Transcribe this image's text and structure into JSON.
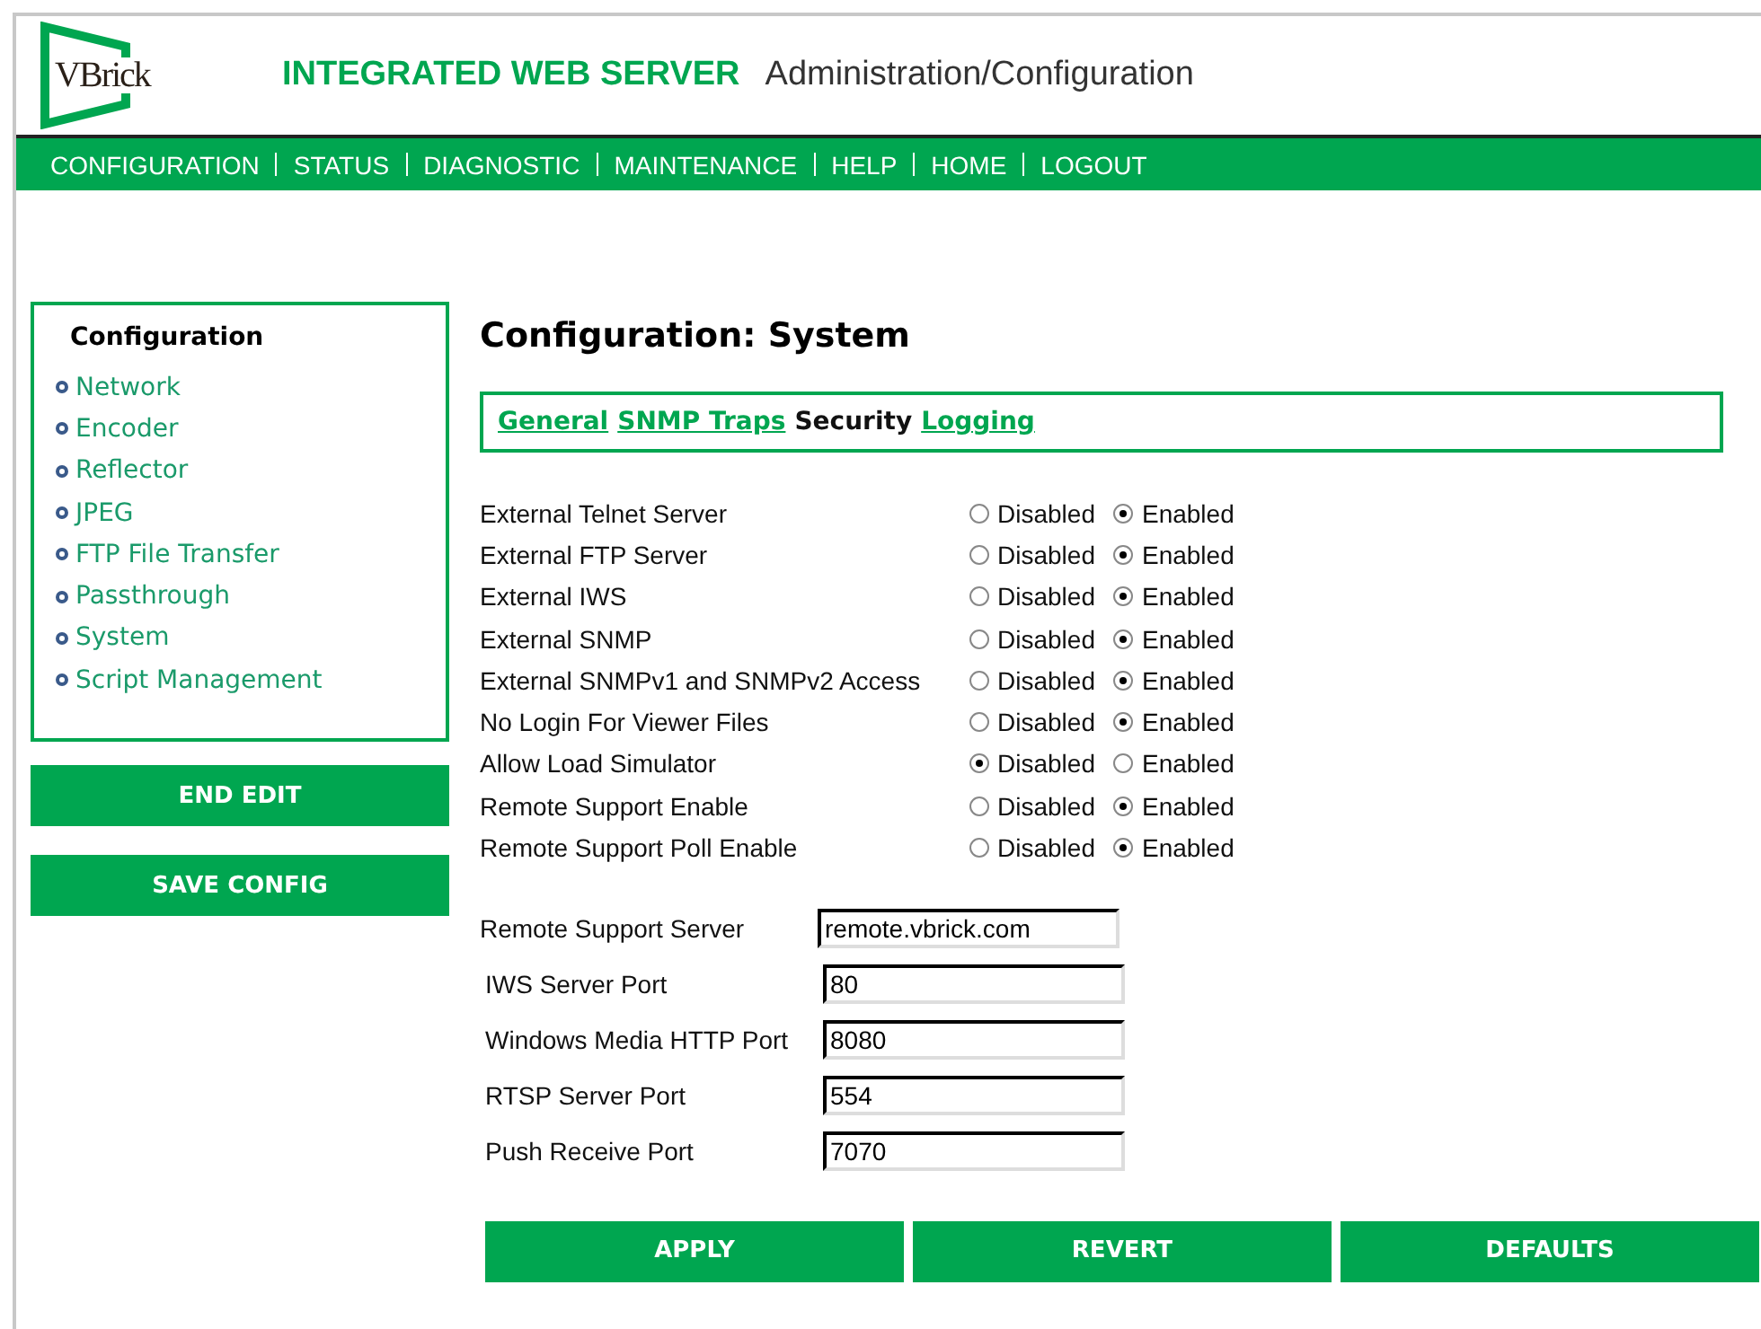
{
  "header": {
    "logo_text": "VBrick",
    "product": "INTEGRATED WEB SERVER",
    "subtitle": "Administration/Configuration"
  },
  "nav": [
    "CONFIGURATION",
    "STATUS",
    "DIAGNOSTIC",
    "MAINTENANCE",
    "HELP",
    "HOME",
    "LOGOUT"
  ],
  "sidebar": {
    "title": "Configuration",
    "items": [
      "Network",
      "Encoder",
      "Reflector",
      "JPEG",
      "FTP File Transfer",
      "Passthrough",
      "System",
      "Script Management"
    ],
    "buttons": [
      "END EDIT",
      "SAVE CONFIG"
    ]
  },
  "page_title": "Configuration: System",
  "tabs": [
    {
      "label": "General",
      "selected": false
    },
    {
      "label": "SNMP Traps",
      "selected": false
    },
    {
      "label": "Security",
      "selected": true
    },
    {
      "label": "Logging",
      "selected": false
    }
  ],
  "settings": [
    {
      "label": "External Telnet Server",
      "options": [
        {
          "label": "Disabled",
          "selected": false
        },
        {
          "label": "Enabled",
          "selected": true
        }
      ]
    },
    {
      "label": "External FTP Server",
      "options": [
        {
          "label": "Disabled",
          "selected": false
        },
        {
          "label": "Enabled",
          "selected": true
        }
      ]
    },
    {
      "label": "External IWS",
      "options": [
        {
          "label": "Disabled",
          "selected": false
        },
        {
          "label": "Enabled",
          "selected": true
        }
      ]
    },
    {
      "label": "External SNMP",
      "options": [
        {
          "label": "Disabled",
          "selected": false
        },
        {
          "label": "Enabled",
          "selected": true
        }
      ]
    },
    {
      "label": "External SNMPv1 and SNMPv2 Access",
      "options": [
        {
          "label": "Disabled",
          "selected": false
        },
        {
          "label": "Enabled",
          "selected": true
        }
      ]
    },
    {
      "label": "No Login For Viewer Files",
      "options": [
        {
          "label": "Disabled",
          "selected": false
        },
        {
          "label": "Enabled",
          "selected": true
        }
      ]
    },
    {
      "label": "Allow Load Simulator",
      "options": [
        {
          "label": "Disabled",
          "selected": true
        },
        {
          "label": "Enabled",
          "selected": false
        }
      ]
    },
    {
      "label": "Remote Support Enable",
      "options": [
        {
          "label": "Disabled",
          "selected": false
        },
        {
          "label": "Enabled",
          "selected": true
        }
      ]
    },
    {
      "label": "Remote Support Poll Enable",
      "options": [
        {
          "label": "Disabled",
          "selected": false
        },
        {
          "label": "Enabled",
          "selected": true
        }
      ]
    }
  ],
  "fields": [
    {
      "label": "Remote Support Server",
      "value": "remote.vbrick.com"
    },
    {
      "label": "IWS Server Port",
      "value": "80"
    },
    {
      "label": "Windows Media HTTP Port",
      "value": "8080"
    },
    {
      "label": "RTSP Server Port",
      "value": "554"
    },
    {
      "label": "Push Receive Port",
      "value": "7070"
    }
  ],
  "actions": [
    "APPLY",
    "REVERT",
    "DEFAULTS"
  ]
}
